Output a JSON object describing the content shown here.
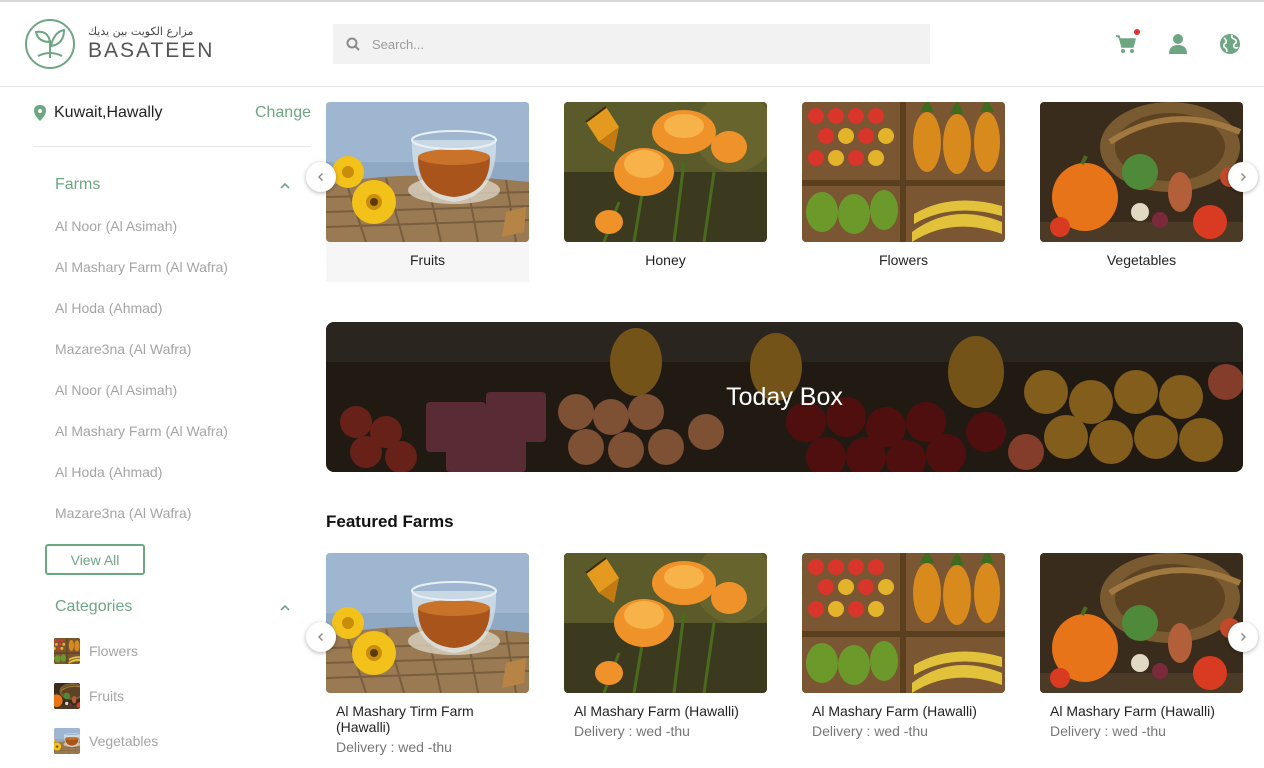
{
  "header": {
    "logo_arabic": "مزارع الكويت بين يديك",
    "logo_name": "BASATEEN",
    "search_placeholder": "Search...",
    "icons": [
      "cart-icon",
      "user-icon",
      "globe-icon"
    ]
  },
  "sidebar": {
    "location": "Kuwait,Hawally",
    "change_label": "Change",
    "farms_title": "Farms",
    "farms": [
      "Al Noor (Al Asimah)",
      "Al Mashary Farm (Al Wafra)",
      "Al Hoda (Ahmad)",
      "Mazare3na (Al Wafra)",
      "Al Noor (Al Asimah)",
      "Al Mashary Farm (Al Wafra)",
      "Al Hoda (Ahmad)",
      "Mazare3na (Al Wafra)"
    ],
    "view_all_label": "View All",
    "categories_title": "Categories",
    "categories": [
      "Flowers",
      "Fruits",
      "Vegetables"
    ]
  },
  "category_cards": [
    "Fruits",
    "Honey",
    "Flowers",
    "Vegetables"
  ],
  "banner": {
    "title": "Today Box"
  },
  "featured": {
    "title": "Featured Farms",
    "farms": [
      {
        "name": "Al Mashary Tirm Farm (Hawalli)",
        "delivery": "Delivery : wed -thu"
      },
      {
        "name": "Al Mashary Farm (Hawalli)",
        "delivery": "Delivery : wed -thu"
      },
      {
        "name": "Al Mashary Farm (Hawalli)",
        "delivery": "Delivery : wed -thu"
      },
      {
        "name": "Al Mashary Farm (Hawalli)",
        "delivery": "Delivery : wed -thu"
      }
    ]
  },
  "colors": {
    "accent": "#6ea684",
    "cart_dot": "#e53030",
    "muted_text": "#a4a4a4"
  }
}
